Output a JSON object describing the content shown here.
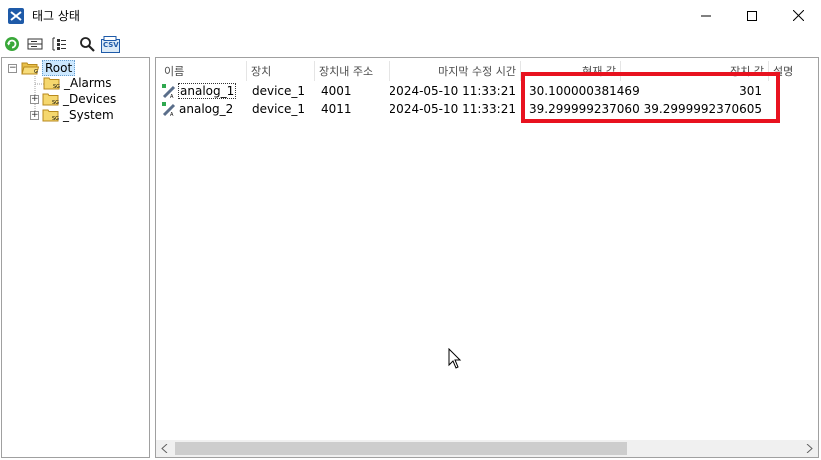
{
  "window": {
    "title": "태그 상태"
  },
  "toolbar": {
    "buttons": [
      "refresh-icon",
      "collapse-icon",
      "expand-icon",
      "search-icon",
      "csv-export-icon"
    ],
    "csv_label": "CSV"
  },
  "tree": {
    "root": "Root",
    "children": [
      {
        "label": "_Alarms"
      },
      {
        "label": "_Devices"
      },
      {
        "label": "_System"
      }
    ]
  },
  "list": {
    "columns": [
      "이름",
      "장치",
      "장치내 주소",
      "마지막 수정 시간",
      "현재 값",
      "장치 값",
      "설명"
    ],
    "rows": [
      {
        "name": "analog_1",
        "device": "device_1",
        "address": "4001",
        "modified": "2024-05-10 11:33:21",
        "current": "30.1000003814697",
        "device_value": "301",
        "description": ""
      },
      {
        "name": "analog_2",
        "device": "device_1",
        "address": "4011",
        "modified": "2024-05-10 11:33:21",
        "current": "39.2999992370605",
        "device_value": "39.2999992370605",
        "description": ""
      }
    ]
  },
  "colors": {
    "highlight": "#e8121f",
    "folder": "#f5d76e"
  }
}
